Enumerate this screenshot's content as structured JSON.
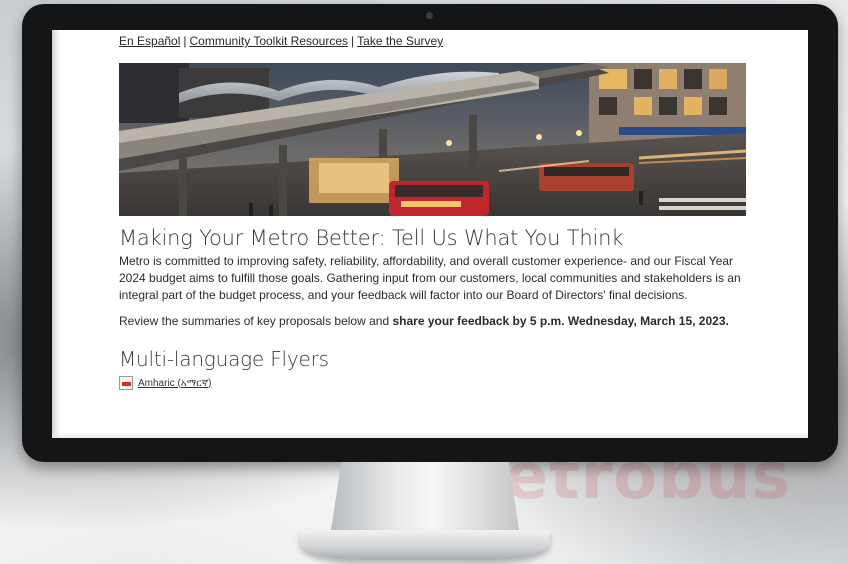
{
  "backdrop": {
    "watermark_text": "Metrobus"
  },
  "nav": {
    "links": [
      {
        "label": "En Español"
      },
      {
        "label": "Community Toolkit Resources"
      },
      {
        "label": "Take the Survey"
      }
    ],
    "separator": "|"
  },
  "hero": {
    "description": "Elevated rail station and bus intersection at dusk"
  },
  "article": {
    "title": "Making Your Metro Better: Tell Us What You Think",
    "intro": "Metro is committed to improving safety, reliability, affordability, and overall customer experience- and our Fiscal Year 2024 budget aims to fulfill those goals. Gathering input from our customers, local communities and stakeholders is an integral part of the budget process, and your feedback will factor into our Board of Directors' final decisions.",
    "review_prefix": "Review the summaries of key proposals below and ",
    "review_bold": "share your feedback by 5 p.m. Wednesday, March 15, 2023."
  },
  "flyers": {
    "heading": "Multi-language Flyers",
    "items": [
      {
        "label": "Amharic (አማርኛ)",
        "icon": "pdf-icon"
      }
    ]
  },
  "colors": {
    "bezel": "#141516",
    "text": "#2b2b2b",
    "heading": "#3a3a3a"
  }
}
